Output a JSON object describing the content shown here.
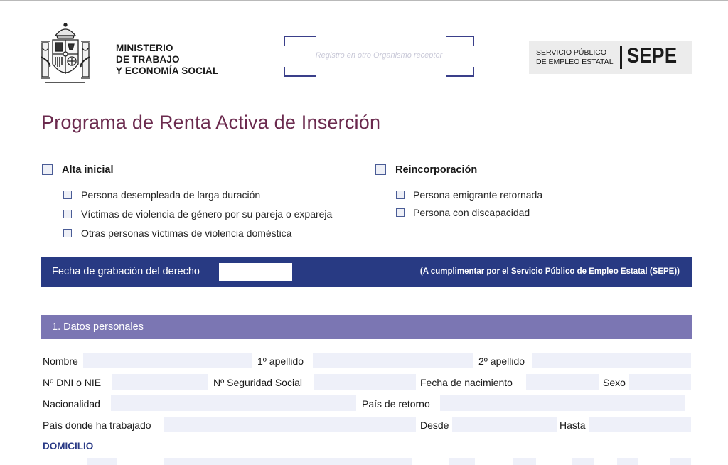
{
  "header": {
    "ministry_lines": [
      "MINISTERIO",
      "DE TRABAJO",
      "Y ECONOMÍA SOCIAL"
    ],
    "registro_placeholder": "Registro en otro Organismo receptor",
    "sepe_small_lines": [
      "SERVICIO PÚBLICO",
      "DE EMPLEO ESTATAL"
    ],
    "sepe_acronym": "SEPE"
  },
  "title": "Programa de Renta Activa de Inserción",
  "options": {
    "alta": {
      "label": "Alta inicial",
      "items": [
        "Persona desempleada de larga duración",
        "Víctimas de violencia de género por su pareja o expareja",
        "Otras personas víctimas de violencia doméstica"
      ]
    },
    "reincorporacion": {
      "label": "Reincorporación",
      "items": [
        "Persona emigrante retornada",
        "Persona con discapacidad"
      ]
    }
  },
  "grabacion": {
    "label": "Fecha de grabación del derecho",
    "value": "",
    "note": "(A cumplimentar por el Servicio Público de Empleo Estatal (SEPE))"
  },
  "section1": {
    "title": "1. Datos personales",
    "fields": {
      "nombre": "Nombre",
      "apellido1": "1º apellido",
      "apellido2": "2º apellido",
      "dni": "Nº DNI o NIE",
      "seguridad_social": "Nº Seguridad Social",
      "fecha_nacimiento": "Fecha de nacimiento",
      "sexo": "Sexo",
      "nacionalidad": "Nacionalidad",
      "pais_retorno": "País de retorno",
      "pais_trabajado": "País donde ha trabajado",
      "desde": "Desde",
      "hasta": "Hasta"
    },
    "domicilio": "DOMICILIO"
  }
}
